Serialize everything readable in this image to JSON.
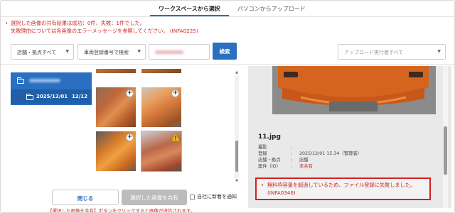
{
  "tabs": [
    {
      "label": "ワークスペースから選択",
      "active": true
    },
    {
      "label": "パソコンからアップロード",
      "active": false
    }
  ],
  "error_summary": {
    "line1": "選択した画像の共有結果は成功：0件、失敗：1件でした。",
    "line2": "失敗理由については各画像のエラーメッセージを参照してください。 (INFA0225)"
  },
  "filters": {
    "location_select": "店舗・拠点すべて",
    "search_type_select": "車両登録番号で検索",
    "search_button": "検索",
    "uploader_select": "アップロード実行者すべて"
  },
  "tree": {
    "date": "2025/12/01",
    "count": "12/12"
  },
  "details": {
    "filename": "11.jpg",
    "rows": [
      {
        "key": "撮影",
        "value": ""
      },
      {
        "key": "登録",
        "value": "2025/12/01 15:34（管理者）"
      },
      {
        "key": "店舗・拠点",
        "value": "店舗"
      },
      {
        "key": "案件（ID）",
        "value": "未共有"
      }
    ],
    "error": "無料枠容量を超過しているため、ファイル登録に失敗しました。 (INFA0346)"
  },
  "buttons": {
    "close": "閉じる",
    "share": "選択した画像を共有",
    "notify_checkbox": "自社に新着を通知"
  },
  "hint": "【選択した画像を共有】ボタンをクリックすると画像が送信されます。",
  "colors": {
    "accent": "#2a6fc0",
    "error": "#cc2a2a",
    "error_border": "#d52020"
  }
}
